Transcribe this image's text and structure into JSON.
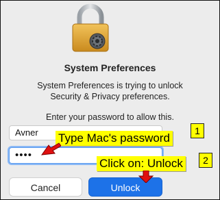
{
  "dialog": {
    "title": "System Preferences",
    "message_line1": "System Preferences is trying to unlock",
    "message_line2": "Security & Privacy preferences.",
    "prompt": "Enter your password to allow this.",
    "username_value": "Avner",
    "password_masked": "••••",
    "cancel_label": "Cancel",
    "unlock_label": "Unlock",
    "accent_color": "#1d72e8"
  },
  "annotations": {
    "step1_text": "Type Mac's password",
    "step1_number": "1",
    "step2_text": "Click on: Unlock",
    "step2_number": "2",
    "highlight_color": "#ffff00",
    "arrow_color": "#e01010"
  },
  "icons": {
    "lock": "padlock-with-gear-icon"
  }
}
